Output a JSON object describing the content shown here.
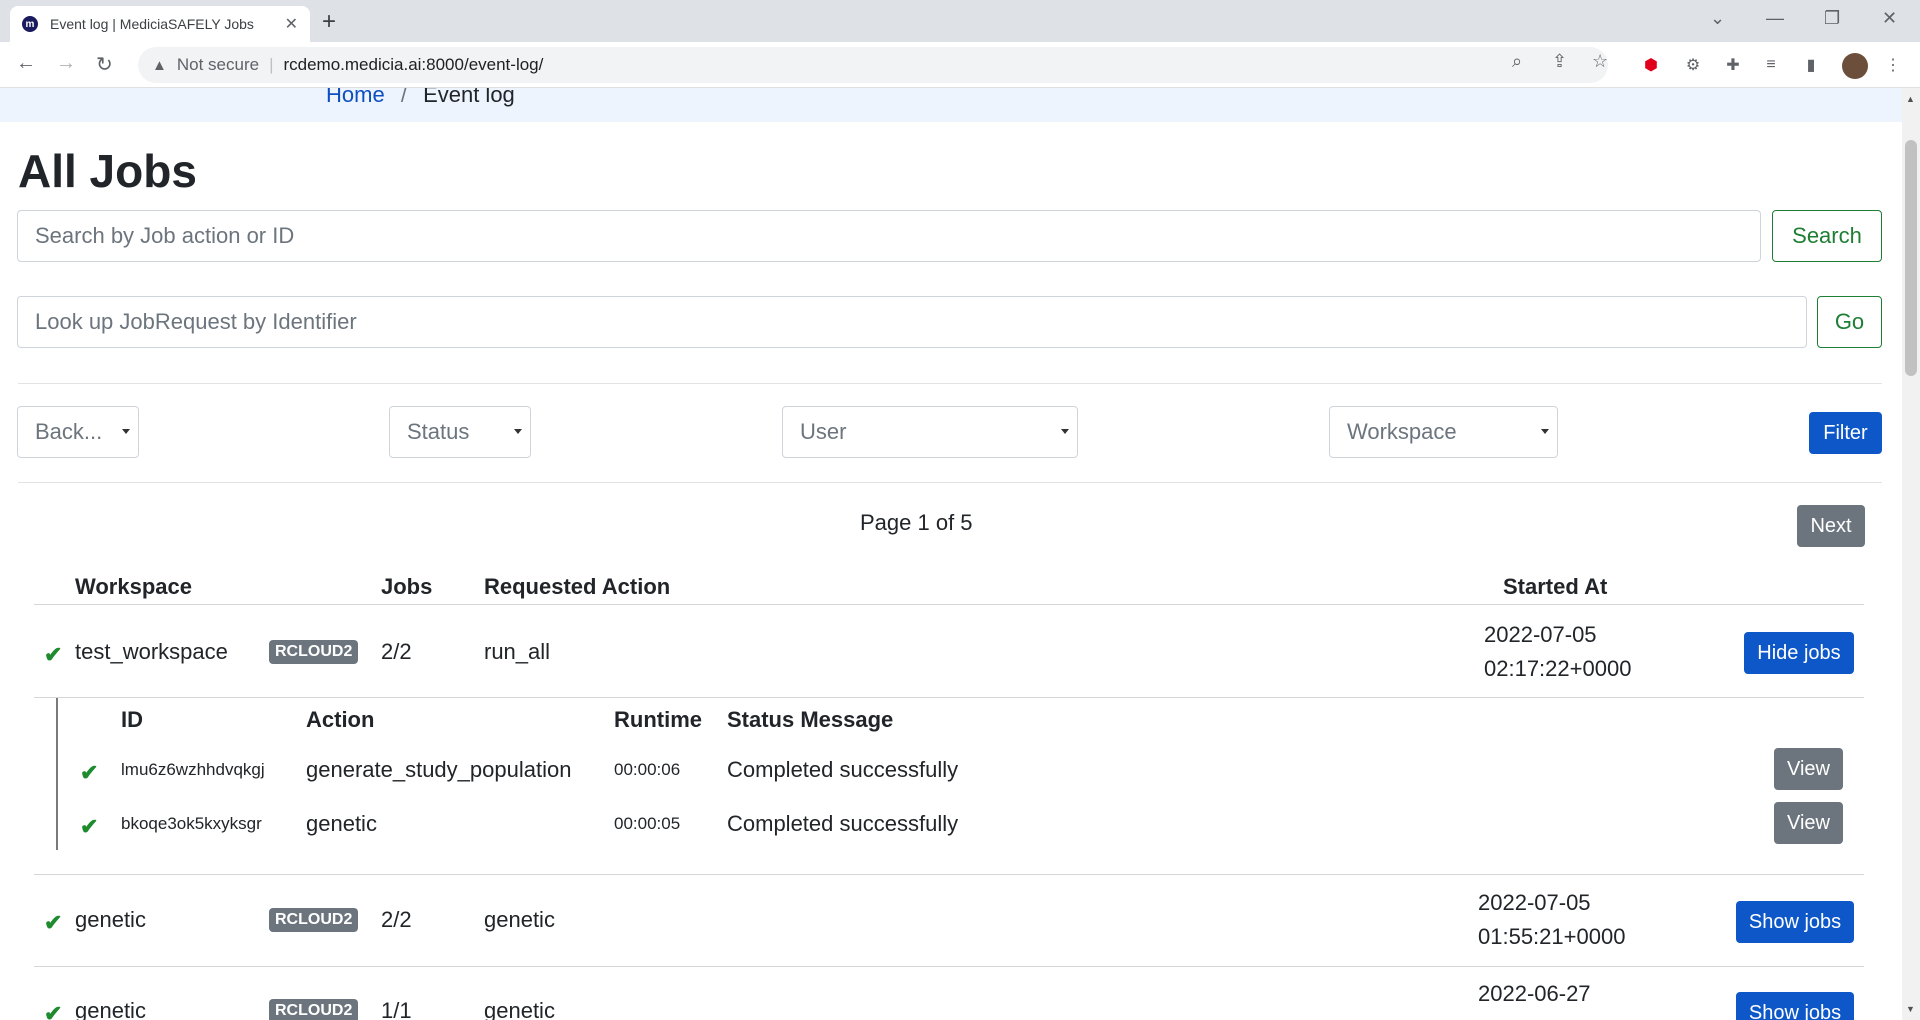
{
  "browser": {
    "tab_title": "Event log | MediciaSAFELY Jobs",
    "favicon_letter": "m",
    "new_tab": "+",
    "security_label": "Not secure",
    "url": "rcdemo.medicia.ai:8000/event-log/"
  },
  "breadcrumb": {
    "home": "Home",
    "separator": "/",
    "current": "Event log"
  },
  "page": {
    "title": "All Jobs",
    "search_placeholder": "Search by Job action or ID",
    "search_button": "Search",
    "lookup_placeholder": "Look up JobRequest by Identifier",
    "go_button": "Go"
  },
  "filters": {
    "backend": "Back...",
    "status": "Status",
    "user": "User",
    "workspace": "Workspace",
    "filter_button": "Filter"
  },
  "pagination": {
    "page_info": "Page 1 of 5",
    "next_button": "Next"
  },
  "table": {
    "headers": {
      "workspace": "Workspace",
      "jobs": "Jobs",
      "requested_action": "Requested Action",
      "started_at": "Started At"
    },
    "rows": [
      {
        "workspace": "test_workspace",
        "backend": "RCLOUD2",
        "jobs": "2/2",
        "action": "run_all",
        "date": "2022-07-05",
        "time": "02:17:22+0000",
        "toggle": "Hide jobs"
      },
      {
        "workspace": "genetic",
        "backend": "RCLOUD2",
        "jobs": "2/2",
        "action": "genetic",
        "date": "2022-07-05",
        "time": "01:55:21+0000",
        "toggle": "Show jobs"
      },
      {
        "workspace": "genetic",
        "backend": "RCLOUD2",
        "jobs": "1/1",
        "action": "genetic",
        "date": "2022-06-27",
        "time": "",
        "toggle": "Show jobs"
      }
    ]
  },
  "jobs_table": {
    "headers": {
      "id": "ID",
      "action": "Action",
      "runtime": "Runtime",
      "status_message": "Status Message"
    },
    "rows": [
      {
        "id": "lmu6z6wzhhdvqkgj",
        "action": "generate_study_population",
        "runtime": "00:00:06",
        "status": "Completed successfully",
        "view": "View"
      },
      {
        "id": "bkoqe3ok5kxyksgr",
        "action": "genetic",
        "runtime": "00:00:05",
        "status": "Completed successfully",
        "view": "View"
      }
    ]
  },
  "icons": {
    "check": "✔"
  },
  "colors": {
    "primary": "#0d57c8",
    "success": "#1e7e34",
    "secondary": "#6c757d"
  }
}
